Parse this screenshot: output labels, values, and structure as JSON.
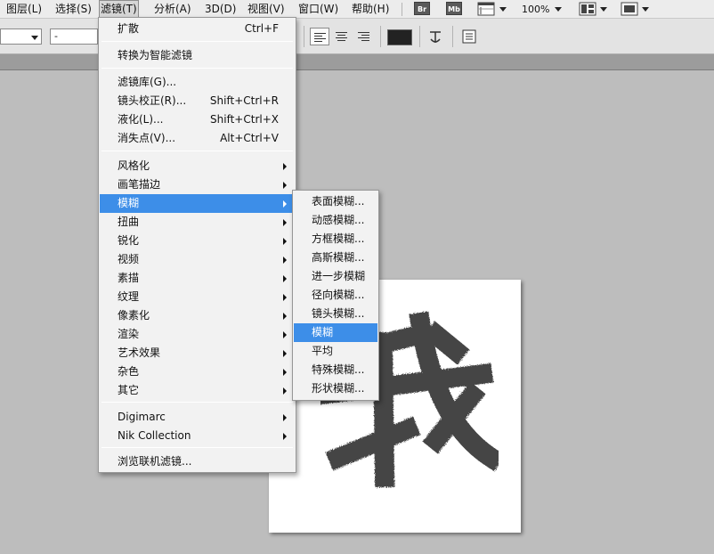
{
  "menubar": {
    "items": [
      "图层(L)",
      "选择(S)",
      "滤镜(T)",
      "分析(A)",
      "3D(D)",
      "视图(V)",
      "窗口(W)",
      "帮助(H)"
    ],
    "badges": [
      "Br",
      "Mb"
    ],
    "zoom": "100%"
  },
  "options": {
    "field_value": "-"
  },
  "filter_menu": {
    "items": [
      {
        "label": "扩散",
        "shortcut": "Ctrl+F"
      },
      {
        "label": "转换为智能滤镜"
      },
      {
        "label": "滤镜库(G)..."
      },
      {
        "label": "镜头校正(R)...",
        "shortcut": "Shift+Ctrl+R"
      },
      {
        "label": "液化(L)...",
        "shortcut": "Shift+Ctrl+X"
      },
      {
        "label": "消失点(V)...",
        "shortcut": "Alt+Ctrl+V"
      },
      {
        "label": "风格化"
      },
      {
        "label": "画笔描边"
      },
      {
        "label": "模糊"
      },
      {
        "label": "扭曲"
      },
      {
        "label": "锐化"
      },
      {
        "label": "视频"
      },
      {
        "label": "素描"
      },
      {
        "label": "纹理"
      },
      {
        "label": "像素化"
      },
      {
        "label": "渲染"
      },
      {
        "label": "艺术效果"
      },
      {
        "label": "杂色"
      },
      {
        "label": "其它"
      },
      {
        "label": "Digimarc"
      },
      {
        "label": "Nik Collection"
      },
      {
        "label": "浏览联机滤镜..."
      }
    ]
  },
  "blur_submenu": {
    "items": [
      "表面模糊...",
      "动感模糊...",
      "方框模糊...",
      "高斯模糊...",
      "进一步模糊",
      "径向模糊...",
      "镜头模糊...",
      "模糊",
      "平均",
      "特殊模糊...",
      "形状模糊..."
    ]
  },
  "canvas": {
    "text": "我",
    "text_color": "#454545"
  },
  "colors": {
    "highlight": "#3d8ee8",
    "menu_bg": "#f2f2f2",
    "workspace_bg": "#bdbdbd"
  }
}
